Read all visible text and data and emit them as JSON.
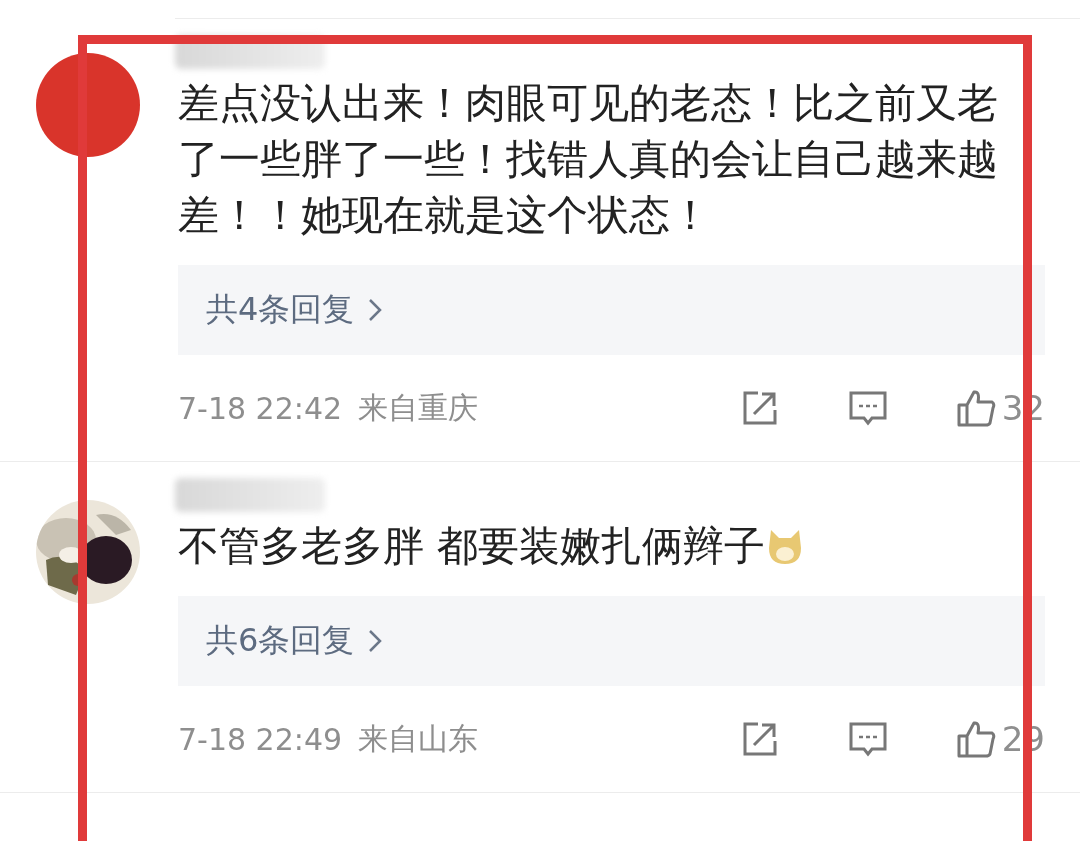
{
  "annotation": {
    "kind": "rectangle"
  },
  "comments": [
    {
      "avatar": {
        "kind": "plain"
      },
      "name_blurred": true,
      "text": "差点没认出来！肉眼可见的老态！比之前又老了一些胖了一些！找错人真的会让自己越来越差！！她现在就是这个状态！",
      "trailing_emoji": false,
      "replies": "共4条回复",
      "time": "7-18 22:42",
      "location": "来自重庆",
      "likes": "32"
    },
    {
      "name_blurred": true,
      "text": "不管多老多胖 都要装嫩扎俩辫子",
      "trailing_emoji": true,
      "replies": "共6条回复",
      "time": "7-18 22:49",
      "location": "来自山东",
      "likes": "29"
    }
  ]
}
